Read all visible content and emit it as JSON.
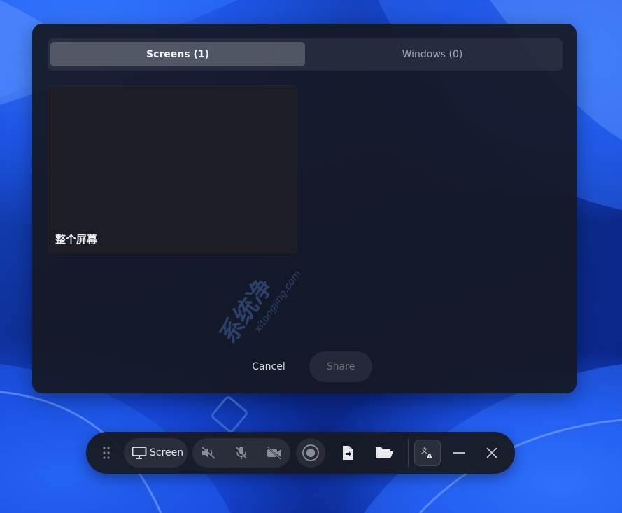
{
  "dialog": {
    "tabs": [
      {
        "label": "Screens (1)",
        "selected": true
      },
      {
        "label": "Windows (0)",
        "selected": false
      }
    ],
    "sources": [
      {
        "label": "整个屏幕"
      }
    ],
    "cancel_label": "Cancel",
    "share_label": "Share"
  },
  "toolbar": {
    "drag_handle_icon": "grip-dots-icon",
    "screen_label": "Screen",
    "icons": [
      "monitor-icon",
      "speaker-muted-icon",
      "mic-muted-icon",
      "camera-off-icon",
      "record-icon",
      "file-export-icon",
      "folder-open-icon",
      "translate-icon",
      "minimize-icon",
      "close-icon"
    ]
  },
  "watermark": {
    "cn": "系统净",
    "en": "xitongjing.com"
  },
  "colors": {
    "dialog_bg": "#151822",
    "accent_wallpaper": "#1e56e6",
    "text_primary": "#f2f3f6",
    "text_muted": "#a3a8b4"
  }
}
